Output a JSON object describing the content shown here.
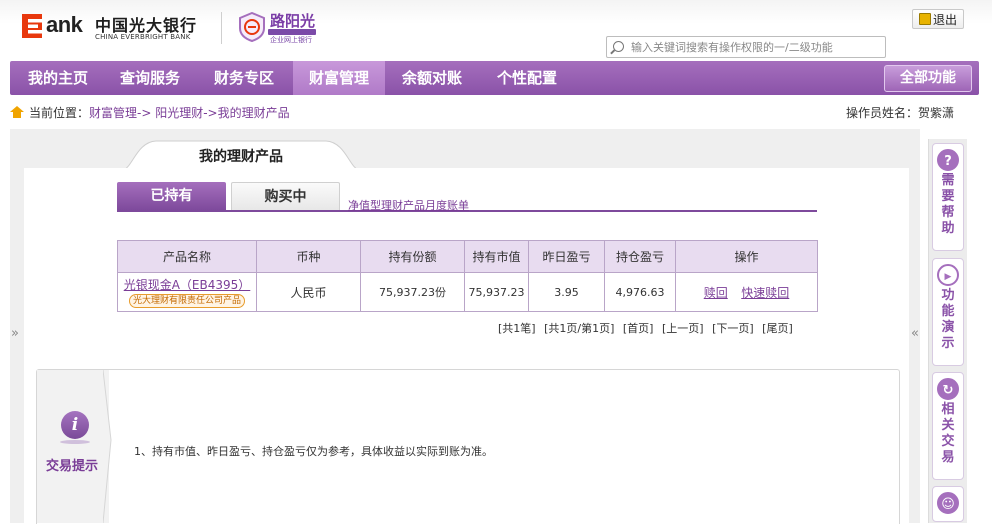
{
  "header": {
    "logo_prefix": "ank",
    "bank_name_cn": "中国光大银行",
    "bank_name_en": "CHINA EVERBRIGHT BANK",
    "sub_brand": "阳光",
    "sub_brand_slogan": "企业网上银行",
    "logout_label": "退出"
  },
  "search": {
    "placeholder": "输入关键词搜索有操作权限的一/二级功能"
  },
  "nav": {
    "items": [
      {
        "label": "我的主页"
      },
      {
        "label": "查询服务"
      },
      {
        "label": "财务专区"
      },
      {
        "label": "财富管理",
        "active": true
      },
      {
        "label": "余额对账"
      },
      {
        "label": "个性配置"
      }
    ],
    "all_functions": "全部功能"
  },
  "breadcrumb": {
    "prefix": "当前位置：",
    "path": "财富管理-> 阳光理财->我的理财产品"
  },
  "operator": "操作员姓名：贺紫潇",
  "page_tab": "我的理财产品",
  "subtabs": {
    "holding": "已持有",
    "buying": "购买中",
    "statement_link": "净值型理财产品月度账单"
  },
  "table": {
    "headers": [
      "产品名称",
      "币种",
      "持有份额",
      "持有市值",
      "昨日盈亏",
      "持仓盈亏",
      "操作"
    ],
    "rows": [
      {
        "name": "光银现金A（EB4395）",
        "issuer": "光大理财有限责任公司产品",
        "currency": "人民币",
        "shares": "75,937.23份",
        "market_value": "75,937.23",
        "yesterday_pnl": "3.95",
        "position_pnl": "4,976.63",
        "actions": [
          "赎回",
          "快速赎回"
        ]
      }
    ]
  },
  "pager": {
    "total": "[共1笔]",
    "pages": "[共1页/第1页]",
    "first": "[首页]",
    "prev": "[上一页]",
    "next": "[下一页]",
    "last": "[尾页]"
  },
  "tip": {
    "title": "交易提示",
    "icon": "info-icon",
    "text": "1、持有市值、昨日盈亏、持仓盈亏仅为参考，具体收益以实际到账为准。"
  },
  "side_arrows": {
    "left": "»",
    "right": "«"
  },
  "right_toolbar": [
    {
      "label": "需要帮助",
      "icon": "help-icon",
      "glyph": "?"
    },
    {
      "label": "功能演示",
      "icon": "play-icon",
      "glyph": "▶"
    },
    {
      "label": "相关交易",
      "icon": "refresh-icon",
      "glyph": "↻"
    },
    {
      "label": "",
      "icon": "smile-icon",
      "glyph": "☺"
    }
  ],
  "colors": {
    "brand_purple": "#8a52a8",
    "brand_red": "#e8380d",
    "link": "#7a3d97"
  }
}
